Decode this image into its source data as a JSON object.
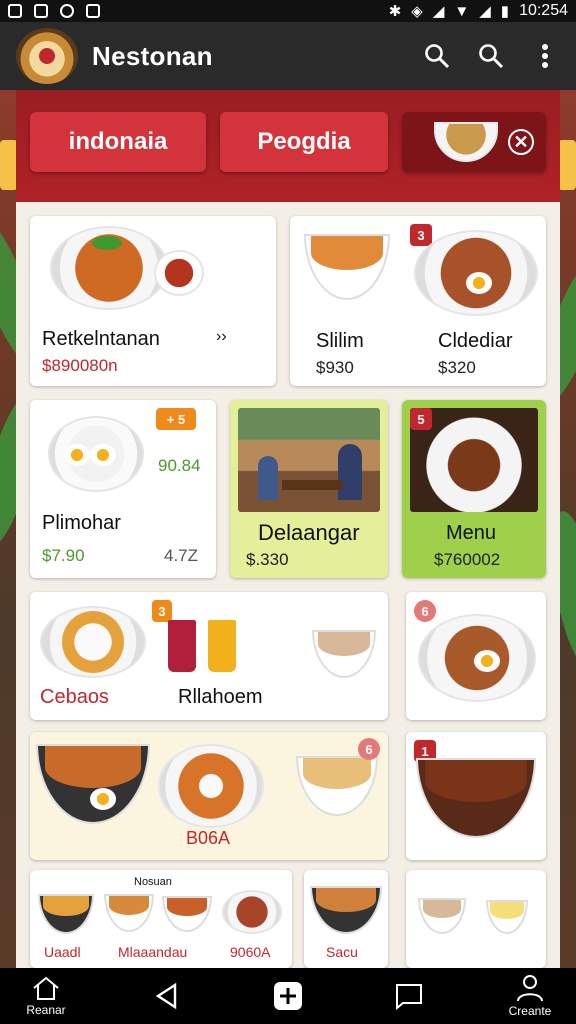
{
  "status_bar": {
    "time": "10:254"
  },
  "app_bar": {
    "title": "Nestonan"
  },
  "chips": {
    "first": "indonaia",
    "second": "Peogdia"
  },
  "cards": [
    {
      "name": "Retkelntanan",
      "arrow": "››",
      "price": "$890080n"
    },
    {
      "badge": "3",
      "name_left": "Slilim",
      "price_left": "$930",
      "name_right": "Cldediar",
      "price_right": "$320"
    },
    {
      "badge": "+ 5",
      "side_value": "90.84",
      "name": "Plimohar",
      "price": "$7.90",
      "price_right": "4.7Z"
    },
    {
      "name": "Delaangar",
      "price": "$.330"
    },
    {
      "badge": "5",
      "name": "Menu",
      "price": "$760002"
    },
    {
      "badge_left": "3",
      "name_left": "Cebaos",
      "name_right": "Rllahoem"
    },
    {
      "badge": "6"
    },
    {
      "badge": "6",
      "name": "B06A"
    },
    {
      "badge": "1"
    },
    {
      "top_label": "Nosuan",
      "labels": [
        "Uaadl",
        "Mlaaandau",
        "9060A"
      ]
    },
    {
      "label": "Sacu"
    },
    {}
  ],
  "nav": {
    "left_label": "Reanar",
    "right_label": "Creante"
  },
  "colors": {
    "brand_red": "#b02228",
    "chip_red": "#d3333a",
    "price_red": "#c0282d",
    "lime": "#e4ef9a",
    "green": "#9ed04c"
  },
  "icons": [
    "search-icon",
    "search-icon",
    "more-vert-icon",
    "close-icon",
    "home-icon",
    "back-icon",
    "add-icon",
    "chat-icon",
    "person-icon"
  ]
}
